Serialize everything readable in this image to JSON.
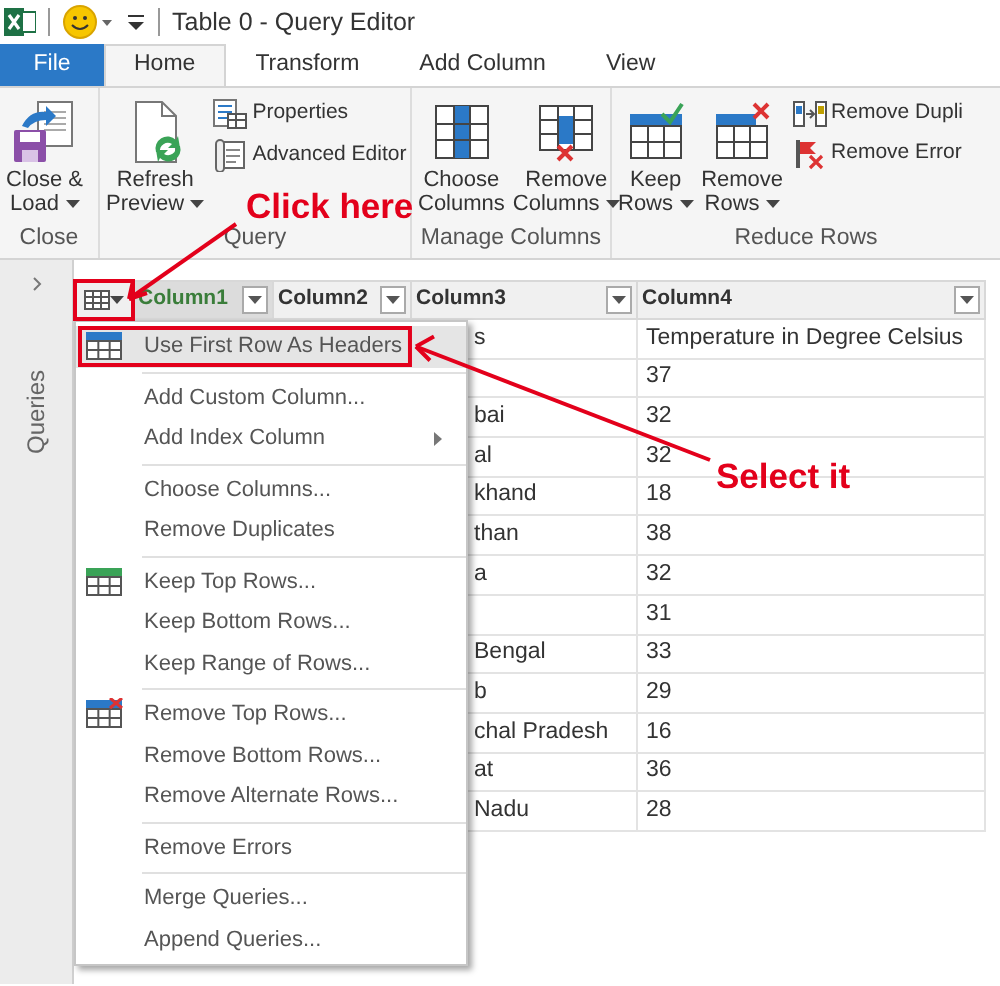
{
  "title_bar": {
    "title": "Table 0 - Query Editor"
  },
  "tabs": [
    {
      "label": "File",
      "kind": "file",
      "selected": false
    },
    {
      "label": "Home",
      "kind": "tab",
      "selected": true
    },
    {
      "label": "Transform",
      "kind": "tab",
      "selected": false
    },
    {
      "label": "Add Column",
      "kind": "tab",
      "selected": false
    },
    {
      "label": "View",
      "kind": "tab",
      "selected": false
    }
  ],
  "ribbon": {
    "groups": [
      {
        "label": "Close",
        "buttons": [
          {
            "kind": "large",
            "lines": [
              "Close &",
              "Load"
            ],
            "dropdown": true
          }
        ]
      },
      {
        "label": "Query",
        "buttons": [
          {
            "kind": "large",
            "lines": [
              "Refresh",
              "Preview"
            ],
            "dropdown": true
          },
          {
            "kind": "small",
            "lines": [
              "Properties"
            ],
            "dropdown": false
          },
          {
            "kind": "small",
            "lines": [
              "Advanced Editor"
            ],
            "dropdown": false
          }
        ]
      },
      {
        "label": "Manage Columns",
        "buttons": [
          {
            "kind": "large",
            "lines": [
              "Choose",
              "Columns"
            ],
            "dropdown": false
          },
          {
            "kind": "large",
            "lines": [
              "Remove",
              "Columns"
            ],
            "dropdown": true
          }
        ]
      },
      {
        "label": "Reduce Rows",
        "buttons": [
          {
            "kind": "large",
            "lines": [
              "Keep",
              "Rows"
            ],
            "dropdown": true
          },
          {
            "kind": "large",
            "lines": [
              "Remove",
              "Rows"
            ],
            "dropdown": true
          },
          {
            "kind": "small",
            "lines": [
              "Remove Dupli"
            ],
            "dropdown": false
          },
          {
            "kind": "small",
            "lines": [
              "Remove Error"
            ],
            "dropdown": false
          }
        ]
      }
    ]
  },
  "sidebar": {
    "label": "Queries"
  },
  "table": {
    "columns": [
      {
        "label": "Column1",
        "selected": true
      },
      {
        "label": "Column2",
        "selected": false
      },
      {
        "label": "Column3",
        "selected": false
      },
      {
        "label": "Column4",
        "selected": false
      }
    ],
    "rows": [
      {
        "column3": "s",
        "column4": "Temperature in Degree Celsius"
      },
      {
        "column4": "37"
      },
      {
        "column3": "bai",
        "column4": "32"
      },
      {
        "column3": "al",
        "column4": "32"
      },
      {
        "column3": "khand",
        "column4": "18"
      },
      {
        "column3": "than",
        "column4": "38"
      },
      {
        "column3": "a",
        "column4": "32"
      },
      {
        "column4": "31"
      },
      {
        "column3": "Bengal",
        "column4": "33"
      },
      {
        "column3": "b",
        "column4": "29"
      },
      {
        "column3": "chal Pradesh",
        "column4": "16"
      },
      {
        "column3": "at",
        "column4": "36"
      },
      {
        "column3": "Nadu",
        "column4": "28"
      }
    ]
  },
  "context_menu": {
    "groups": [
      [
        {
          "label": "Use First Row As Headers",
          "selected": true,
          "submenu": false
        }
      ],
      [
        {
          "label": "Add Custom Column...",
          "selected": false,
          "submenu": false
        },
        {
          "label": "Add Index Column",
          "selected": false,
          "submenu": true
        }
      ],
      [
        {
          "label": "Choose Columns...",
          "selected": false,
          "submenu": false
        },
        {
          "label": "Remove Duplicates",
          "selected": false,
          "submenu": false
        }
      ],
      [
        {
          "label": "Keep Top Rows...",
          "selected": false,
          "submenu": false
        },
        {
          "label": "Keep Bottom Rows...",
          "selected": false,
          "submenu": false
        },
        {
          "label": "Keep Range of Rows...",
          "selected": false,
          "submenu": false
        }
      ],
      [
        {
          "label": "Remove Top Rows...",
          "selected": false,
          "submenu": false
        },
        {
          "label": "Remove Bottom Rows...",
          "selected": false,
          "submenu": false
        },
        {
          "label": "Remove Alternate Rows...",
          "selected": false,
          "submenu": false
        }
      ],
      [
        {
          "label": "Remove Errors",
          "selected": false,
          "submenu": false
        }
      ],
      [
        {
          "label": "Merge Queries...",
          "selected": false,
          "submenu": false
        },
        {
          "label": "Append Queries...",
          "selected": false,
          "submenu": false
        }
      ]
    ]
  },
  "annotations": [
    {
      "kind": "callout",
      "text": "Click here"
    },
    {
      "kind": "callout",
      "text": "Select it"
    }
  ]
}
